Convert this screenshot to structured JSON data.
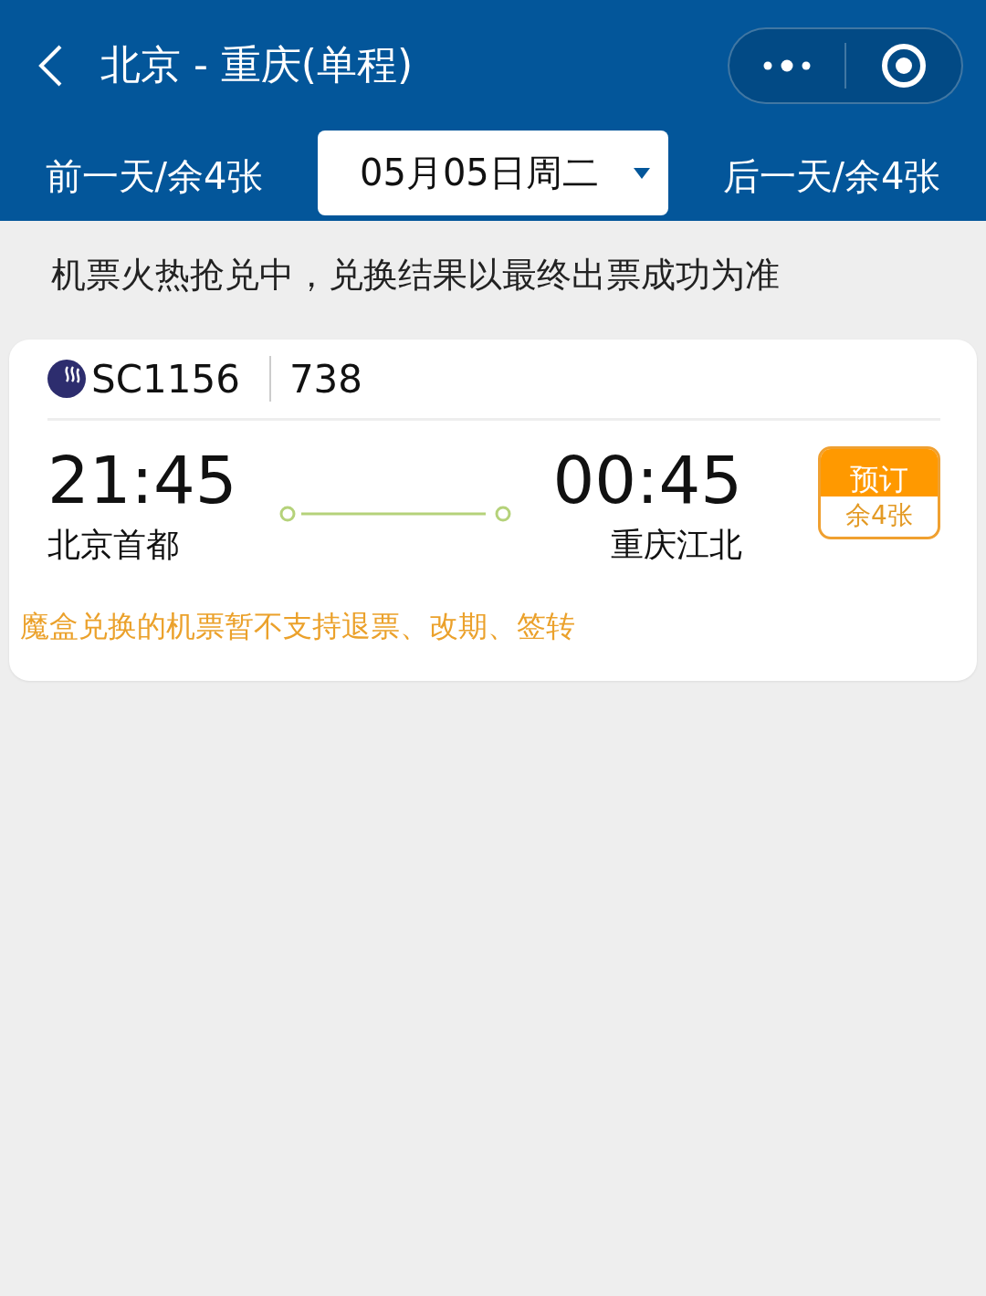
{
  "header": {
    "title": "北京 - 重庆(单程)"
  },
  "date_bar": {
    "previous": "前一天/余4张",
    "date": "05月05日周二",
    "next": "后一天/余4张"
  },
  "notice": "机票火热抢兑中，兑换结果以最终出票成功为准",
  "flights": [
    {
      "flight_no": "SC1156",
      "aircraft": "738",
      "depart_time": "21:45",
      "depart_airport": "北京首都",
      "arrive_time": "00:45",
      "arrive_airport": "重庆江北",
      "book_label": "预订",
      "remaining": "余4张",
      "note": "魔盒兑换的机票暂不支持退票、改期、签转"
    }
  ]
}
